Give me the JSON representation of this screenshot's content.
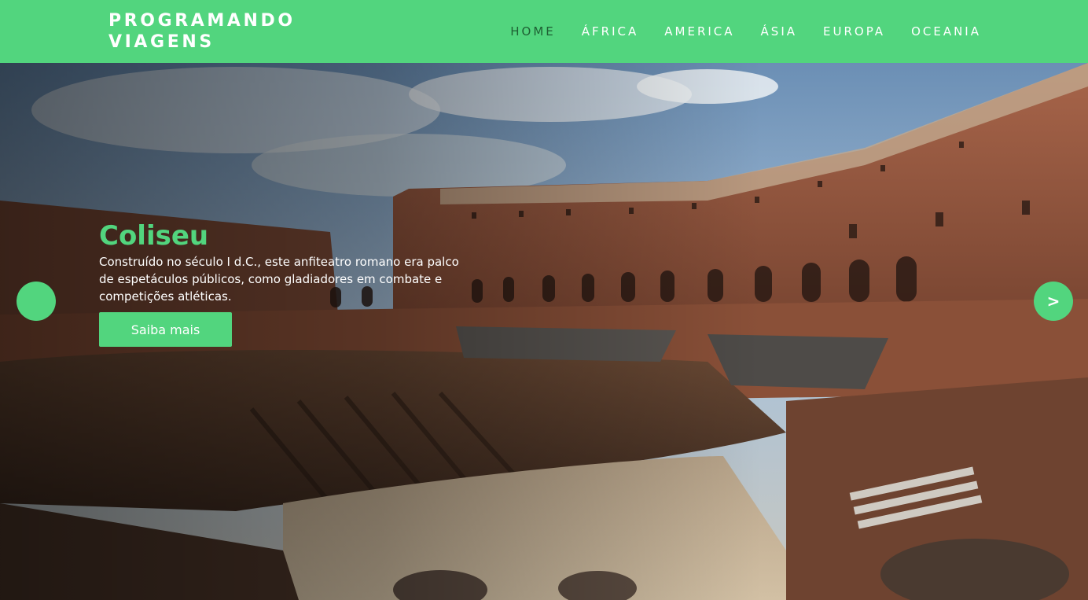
{
  "brand": {
    "line1": "PROGRAMANDO",
    "line2": "VIAGENS"
  },
  "nav": {
    "items": [
      {
        "label": "HOME",
        "active": true
      },
      {
        "label": "ÁFRICA"
      },
      {
        "label": "AMERICA"
      },
      {
        "label": "ÁSIA"
      },
      {
        "label": "EUROPA"
      },
      {
        "label": "OCEANIA"
      }
    ]
  },
  "slide": {
    "title": "Coliseu",
    "description": "Construído no século I d.C., este anfiteatro romano era palco de espetáculos públicos, como gladiadores em combate e competições atléticas.",
    "cta_label": "Saiba mais",
    "next_label": ">",
    "prev_label": ""
  },
  "colors": {
    "accent": "#52d57e",
    "active_nav": "#1e5f33",
    "text_light": "#ffffff"
  },
  "icons": {
    "prev": "chevron-left-icon",
    "next": "chevron-right-icon"
  }
}
